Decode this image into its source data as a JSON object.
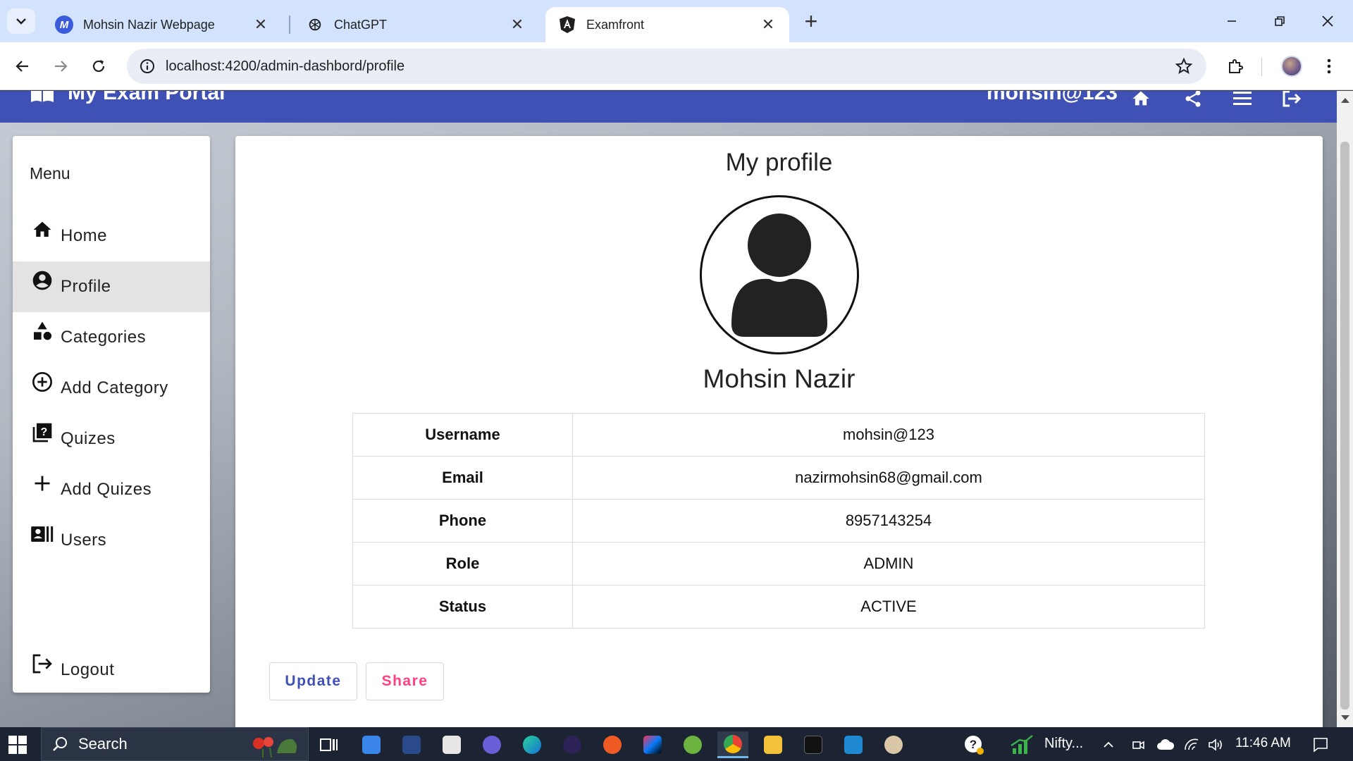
{
  "browser": {
    "tabs": [
      {
        "title": "Mohsin Nazir Webpage",
        "favicon": "M",
        "favicon_color": "#3b5bdb",
        "active": false
      },
      {
        "title": "ChatGPT",
        "favicon": "chatgpt-logo",
        "active": false
      },
      {
        "title": "Examfront",
        "favicon": "angular-logo",
        "active": true
      }
    ],
    "url": "localhost:4200/admin-dashbord/profile"
  },
  "app": {
    "brand": "My Exam Portal",
    "username": "mohsin@123",
    "nav_color": "#3f51b5"
  },
  "sidebar": {
    "heading": "Menu",
    "items": [
      {
        "label": "Home",
        "icon": "home-icon",
        "active": false
      },
      {
        "label": "Profile",
        "icon": "account-circle-icon",
        "active": true
      },
      {
        "label": "Categories",
        "icon": "category-icon",
        "active": false
      },
      {
        "label": "Add Category",
        "icon": "add-circle-outline-icon",
        "active": false
      },
      {
        "label": "Quizes",
        "icon": "quiz-icon",
        "active": false
      },
      {
        "label": "Add Quizes",
        "icon": "plus-icon",
        "active": false
      },
      {
        "label": "Users",
        "icon": "recent-actors-icon",
        "active": false
      }
    ],
    "logout_label": "Logout"
  },
  "profile": {
    "title": "My profile",
    "full_name": "Mohsin Nazir",
    "details": [
      {
        "key": "Username",
        "value": "mohsin@123"
      },
      {
        "key": "Email",
        "value": "nazirmohsin68@gmail.com"
      },
      {
        "key": "Phone",
        "value": "8957143254"
      },
      {
        "key": "Role",
        "value": "ADMIN"
      },
      {
        "key": "Status",
        "value": "ACTIVE"
      }
    ],
    "update_label": "Update",
    "share_label": "Share",
    "update_color": "#3f51b5",
    "share_color": "#ff4081"
  },
  "taskbar": {
    "search_label": "Search",
    "weather_label": "Nifty...",
    "clock": "11:46 AM"
  }
}
